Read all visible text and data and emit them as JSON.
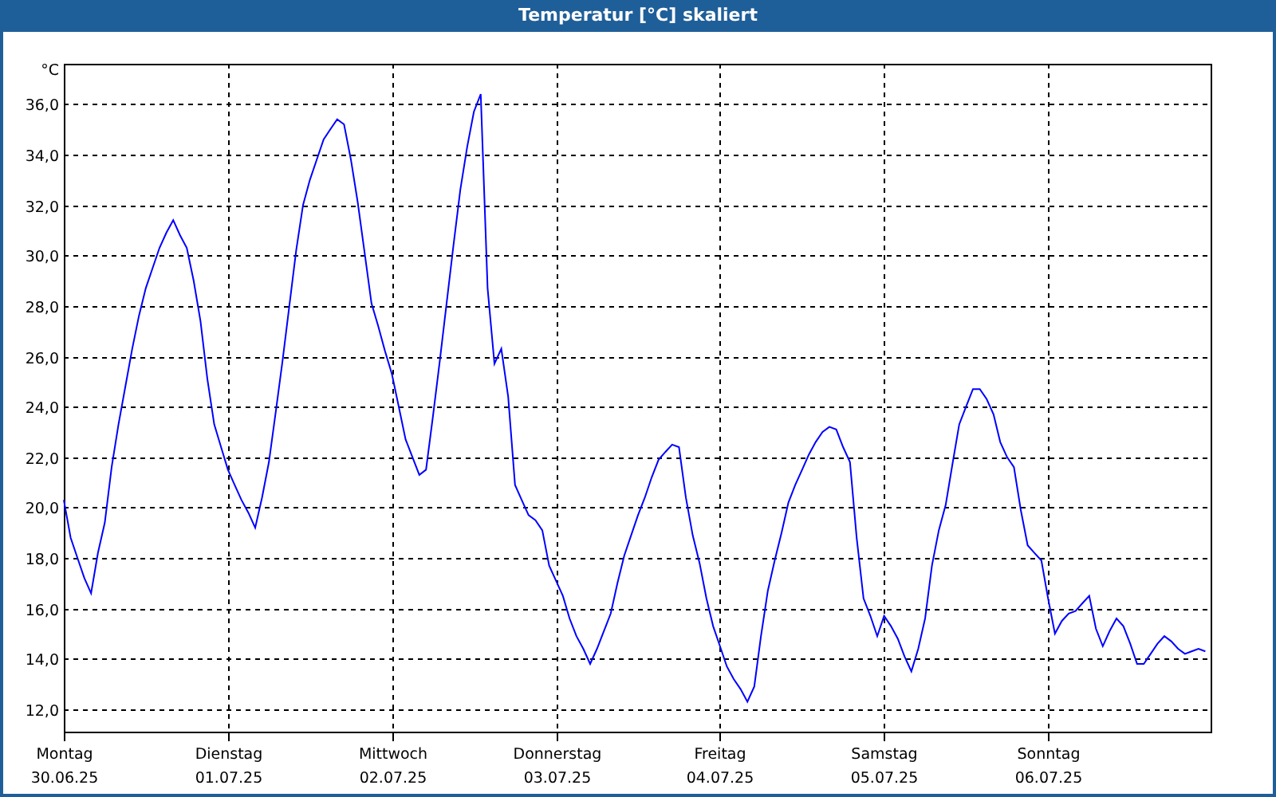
{
  "window": {
    "title": "Temperatur [°C] skaliert"
  },
  "chart": {
    "chart_data": {
      "type": "line",
      "ylabel": "°C",
      "categories": [
        "Montag\n30.06.25",
        null,
        null,
        null,
        null,
        null,
        null,
        null,
        null,
        null,
        null,
        null,
        null,
        null,
        null,
        null,
        null,
        null,
        null,
        null,
        null,
        null,
        null,
        null,
        "Dienstag\n01.07.25",
        null,
        null,
        null,
        null,
        null,
        null,
        null,
        null,
        null,
        null,
        null,
        null,
        null,
        null,
        null,
        null,
        null,
        null,
        null,
        null,
        null,
        null,
        null,
        "Mittwoch\n02.07.25",
        null,
        null,
        null,
        null,
        null,
        null,
        null,
        null,
        null,
        null,
        null,
        null,
        null,
        null,
        null,
        null,
        null,
        null,
        null,
        null,
        null,
        null,
        null,
        "Donnerstag\n03.07.25",
        null,
        null,
        null,
        null,
        null,
        null,
        null,
        null,
        null,
        null,
        null,
        null,
        null,
        null,
        null,
        null,
        null,
        null,
        null,
        null,
        null,
        null,
        null,
        "Freitag\n04.07.25",
        null,
        null,
        null,
        null,
        null,
        null,
        null,
        null,
        null,
        null,
        null,
        null,
        null,
        null,
        null,
        null,
        null,
        null,
        null,
        null,
        null,
        null,
        null,
        "Samstag\n05.07.25",
        null,
        null,
        null,
        null,
        null,
        null,
        null,
        null,
        null,
        null,
        null,
        null,
        null,
        null,
        null,
        null,
        null,
        null,
        null,
        null,
        null,
        null,
        null,
        "Sonntag\n06.07.25",
        null,
        null,
        null,
        null,
        null,
        null,
        null,
        null,
        null,
        null,
        null,
        null,
        null,
        null,
        null,
        null,
        null,
        null,
        null,
        null,
        null,
        null,
        null,
        null
      ],
      "series": [
        {
          "color": "#0000ff",
          "values": [
            20.3,
            18.8,
            18.0,
            17.2,
            16.6,
            18.2,
            19.4,
            21.6,
            23.3,
            24.8,
            26.3,
            27.6,
            28.7,
            29.5,
            30.3,
            30.9,
            31.4,
            30.8,
            30.3,
            29.0,
            27.4,
            25.1,
            23.3,
            22.4,
            21.5,
            20.9,
            20.3,
            19.8,
            19.2,
            20.4,
            21.8,
            23.8,
            25.8,
            28.0,
            30.2,
            32.0,
            33.0,
            33.8,
            34.6,
            35.0,
            35.4,
            35.2,
            33.8,
            32.1,
            30.1,
            28.1,
            27.2,
            26.2,
            25.3,
            24.0,
            22.7,
            22.0,
            21.3,
            21.5,
            23.6,
            25.8,
            28.1,
            30.4,
            32.6,
            34.3,
            35.7,
            36.4,
            28.7,
            25.7,
            26.3,
            24.4,
            20.9,
            20.3,
            19.7,
            19.5,
            19.1,
            17.7,
            17.1,
            16.5,
            15.6,
            14.9,
            14.4,
            13.8,
            14.4,
            15.1,
            15.8,
            17.0,
            18.1,
            18.9,
            19.7,
            20.4,
            21.2,
            21.9,
            22.2,
            22.5,
            22.4,
            20.4,
            18.9,
            17.8,
            16.4,
            15.3,
            14.5,
            13.7,
            13.2,
            12.8,
            12.3,
            12.9,
            14.9,
            16.7,
            17.9,
            19.0,
            20.2,
            20.9,
            21.5,
            22.1,
            22.6,
            23.0,
            23.2,
            23.1,
            22.4,
            21.8,
            18.8,
            16.4,
            15.7,
            14.9,
            15.7,
            15.3,
            14.8,
            14.1,
            13.5,
            14.4,
            15.6,
            17.7,
            19.1,
            20.1,
            21.7,
            23.3,
            24.0,
            24.7,
            24.7,
            24.3,
            23.7,
            22.6,
            22.0,
            21.6,
            19.9,
            18.5,
            18.2,
            17.9,
            16.4,
            15.0,
            15.5,
            15.8,
            15.9,
            16.2,
            16.5,
            15.2,
            14.5,
            15.1,
            15.6,
            15.3,
            14.6,
            13.8,
            13.8,
            14.2,
            14.6,
            14.9,
            14.7,
            14.4,
            14.2,
            14.3,
            14.4,
            14.3,
            null
          ]
        }
      ],
      "ylim": [
        11.05,
        37.6
      ],
      "grid": true,
      "yticks": [
        {
          "value": 12,
          "label": "12,0"
        },
        {
          "value": 14,
          "label": "14,0"
        },
        {
          "value": 16,
          "label": "16,0"
        },
        {
          "value": 18,
          "label": "18,0"
        },
        {
          "value": 20,
          "label": "20,0"
        },
        {
          "value": 22,
          "label": "22,0"
        },
        {
          "value": 24,
          "label": "24,0"
        },
        {
          "value": 26,
          "label": "26,0"
        },
        {
          "value": 28,
          "label": "28,0"
        },
        {
          "value": 30,
          "label": "30,0"
        },
        {
          "value": 32,
          "label": "32,0"
        },
        {
          "value": 34,
          "label": "34,0"
        },
        {
          "value": 36,
          "label": "36,0"
        }
      ]
    }
  }
}
